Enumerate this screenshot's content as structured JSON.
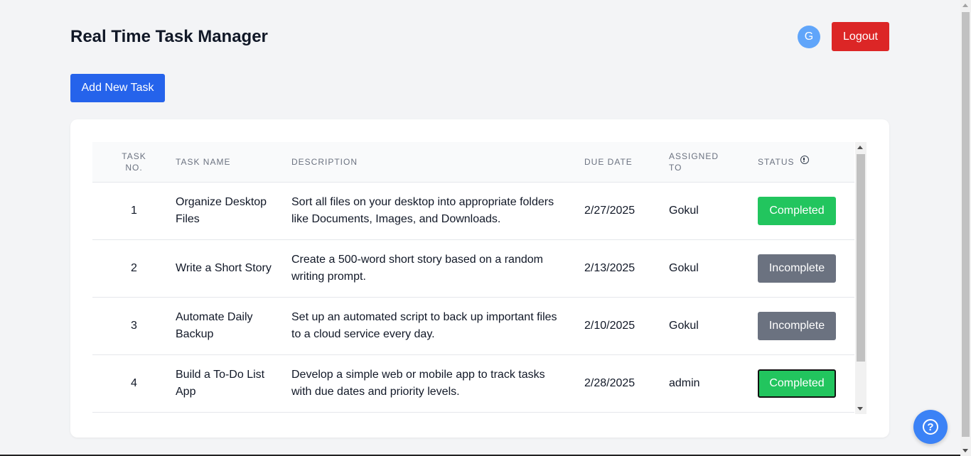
{
  "header": {
    "title": "Real Time Task Manager",
    "avatar_initial": "G",
    "logout_label": "Logout"
  },
  "actions": {
    "add_task_label": "Add New Task"
  },
  "table": {
    "columns": {
      "task_no": "TASK NO.",
      "task_name": "TASK NAME",
      "description": "DESCRIPTION",
      "due_date": "DUE DATE",
      "assigned_to": "ASSIGNED TO",
      "status": "STATUS"
    },
    "rows": [
      {
        "no": "1",
        "name": "Organize Desktop Files",
        "description": "Sort all files on your desktop into appropriate folders like Documents, Images, and Downloads.",
        "due": "2/27/2025",
        "assigned": "Gokul",
        "status": "Completed"
      },
      {
        "no": "2",
        "name": "Write a Short Story",
        "description": "Create a 500-word short story based on a random writing prompt.",
        "due": "2/13/2025",
        "assigned": "Gokul",
        "status": "Incomplete"
      },
      {
        "no": "3",
        "name": "Automate Daily Backup",
        "description": "Set up an automated script to back up important files to a cloud service every day.",
        "due": "2/10/2025",
        "assigned": "Gokul",
        "status": "Incomplete"
      },
      {
        "no": "4",
        "name": "Build a To-Do List App",
        "description": "Develop a simple web or mobile app to track tasks with due dates and priority levels.",
        "due": "2/28/2025",
        "assigned": "admin",
        "status": "Completed"
      }
    ]
  },
  "colors": {
    "primary": "#2563eb",
    "danger": "#dc2626",
    "completed": "#22c55e",
    "incomplete": "#6b7280",
    "avatar": "#60a5fa",
    "help": "#3b82f6"
  },
  "icons": {
    "status_info": "info-icon",
    "help": "question-circle-icon"
  }
}
